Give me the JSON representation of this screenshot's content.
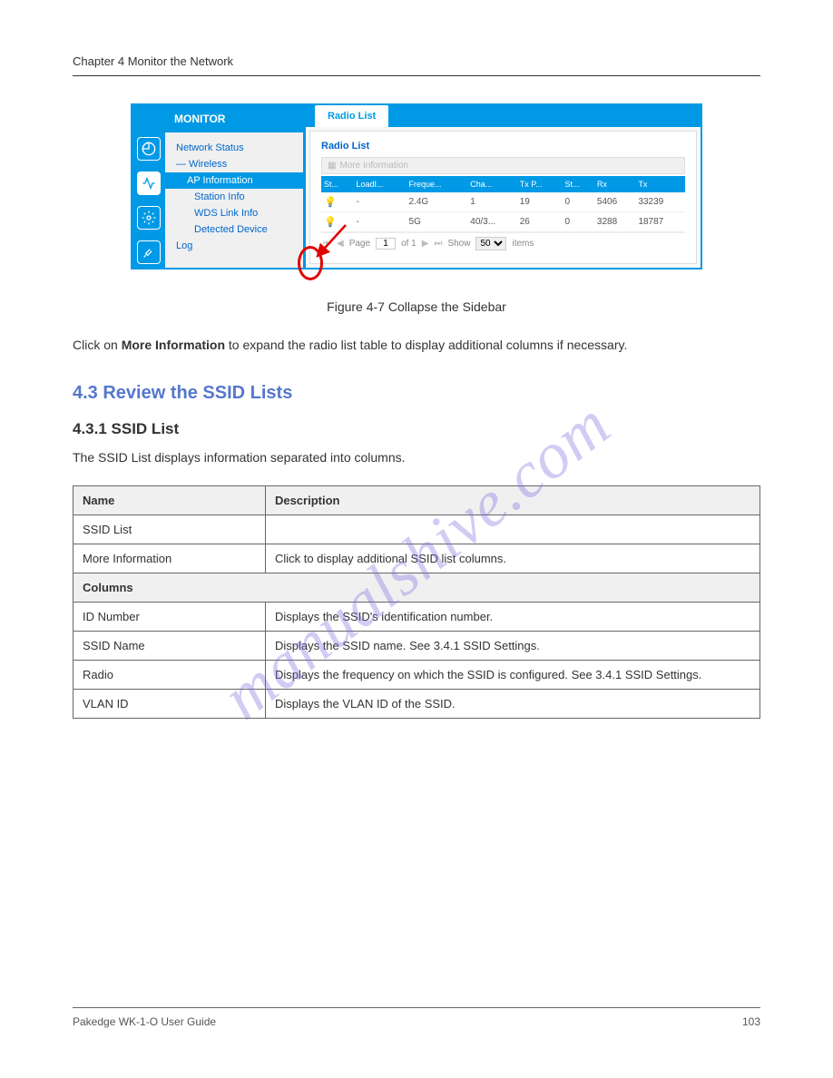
{
  "header_text": "Chapter 4 Monitor the Network",
  "watermark": "manualshive.com",
  "screenshot": {
    "sidebar_title": "MONITOR",
    "nav": {
      "network_status": "Network Status",
      "wireless": "— Wireless",
      "ap_information": "AP Information",
      "station_info": "Station Info",
      "wds_link_info": "WDS Link Info",
      "detected_device": "Detected Device",
      "log": "Log"
    },
    "tab_label": "Radio List",
    "panel_heading": "Radio List",
    "more_info_label": "More Information",
    "columns": [
      "St...",
      "LoadI...",
      "Freque...",
      "Cha...",
      "Tx P...",
      "St...",
      "Rx",
      "Tx"
    ],
    "rows": [
      {
        "st": "",
        "load": "-",
        "freq": "2.4G",
        "cha": "1",
        "txp": "19",
        "st2": "0",
        "rx": "5406",
        "tx": "33239"
      },
      {
        "st": "",
        "load": "-",
        "freq": "5G",
        "cha": "40/3...",
        "txp": "26",
        "st2": "0",
        "rx": "3288",
        "tx": "18787"
      }
    ],
    "pagination": {
      "page_label": "Page",
      "page_value": "1",
      "of_label": "of 1",
      "show_label": "Show",
      "show_value": "50",
      "items_label": "items"
    }
  },
  "figure_caption": "Figure 4-7    Collapse the Sidebar",
  "paragraph_1_prefix": "Click on ",
  "paragraph_1_bold": "More Information",
  "paragraph_1_suffix": " to expand the radio list table to display additional columns if necessary.",
  "review_title": "4.3  Review the SSID Lists",
  "ssid_list_title": "4.3.1  SSID List",
  "ssid_paragraph": "The SSID List displays information separated into columns.",
  "table": {
    "headers": [
      "Name",
      "Description"
    ],
    "rows": [
      {
        "name": "SSID List",
        "desc": "",
        "is_section": false
      },
      {
        "name": "More Information",
        "desc": "Click to display additional SSID list columns.",
        "is_section": false
      },
      {
        "name": "Columns",
        "desc": "",
        "is_section": true
      },
      {
        "name": "ID Number",
        "desc": "Displays the SSID's identification number.",
        "is_section": false
      },
      {
        "name": "SSID Name",
        "desc": "Displays the SSID name. See 3.4.1 SSID Settings.",
        "is_section": false
      },
      {
        "name": "Radio",
        "desc": "Displays the frequency on which the SSID is configured. See 3.4.1 SSID Settings.",
        "is_section": false
      },
      {
        "name": "VLAN ID",
        "desc": "Displays the VLAN ID of the SSID.",
        "is_section": false
      }
    ]
  },
  "footer": {
    "left": "Pakedge WK-1-O User Guide",
    "right": "103"
  }
}
